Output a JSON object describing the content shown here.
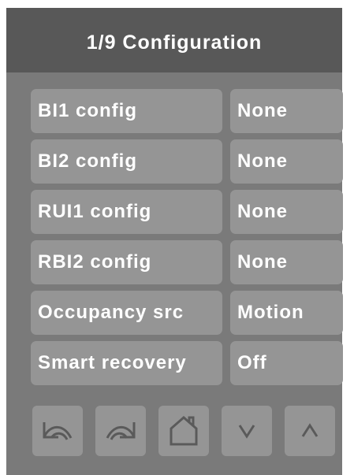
{
  "header": {
    "title": "1/9 Configuration"
  },
  "settings": [
    {
      "label": "BI1 config",
      "value": "None"
    },
    {
      "label": "BI2 config",
      "value": "None"
    },
    {
      "label": "RUI1 config",
      "value": "None"
    },
    {
      "label": "RBI2 config",
      "value": "None"
    },
    {
      "label": "Occupancy src",
      "value": "Motion"
    },
    {
      "label": "Smart recovery",
      "value": "Off"
    }
  ],
  "navbar": {
    "buttons": [
      {
        "icon": "undo-icon"
      },
      {
        "icon": "redo-icon"
      },
      {
        "icon": "home-icon"
      },
      {
        "icon": "chevron-down-icon"
      },
      {
        "icon": "chevron-up-icon"
      }
    ]
  },
  "colors": {
    "panel_background": "#7a7a7a",
    "header_background": "#585858",
    "cell_background": "#959595",
    "icon_stroke": "#5a5a5a",
    "text": "#ffffff"
  }
}
